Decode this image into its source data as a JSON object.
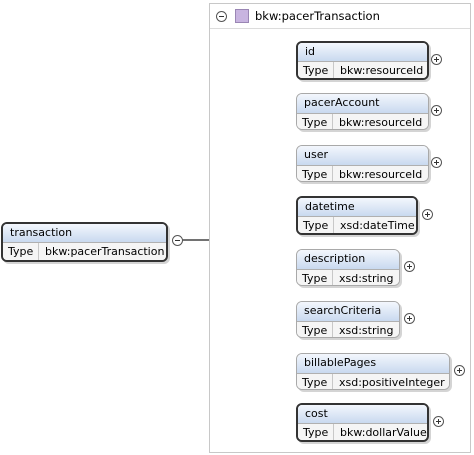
{
  "root": {
    "name": "transaction",
    "type_label": "Type",
    "type_value": "bkw:pacerTransaction"
  },
  "panel": {
    "title": "bkw:pacerTransaction"
  },
  "children": [
    {
      "name": "id",
      "type_label": "Type",
      "type_value": "bkw:resourceId",
      "required": true
    },
    {
      "name": "pacerAccount",
      "type_label": "Type",
      "type_value": "bkw:resourceId",
      "required": false
    },
    {
      "name": "user",
      "type_label": "Type",
      "type_value": "bkw:resourceId",
      "required": false
    },
    {
      "name": "datetime",
      "type_label": "Type",
      "type_value": "xsd:dateTime",
      "required": true
    },
    {
      "name": "description",
      "type_label": "Type",
      "type_value": "xsd:string",
      "required": false
    },
    {
      "name": "searchCriteria",
      "type_label": "Type",
      "type_value": "xsd:string",
      "required": false
    },
    {
      "name": "billablePages",
      "type_label": "Type",
      "type_value": "xsd:positiveInteger",
      "required": false
    },
    {
      "name": "cost",
      "type_label": "Type",
      "type_value": "bkw:dollarValue",
      "required": true
    }
  ],
  "icons": {
    "collapse": "minus-circle-icon",
    "expand": "plus-circle-icon",
    "complex_type": "complex-type-square-icon",
    "compositor": "sequence-compositor-icon"
  },
  "colors": {
    "header_top": "#f3f7fd",
    "header_bottom": "#c9d9ef",
    "complex_type": "#c8b4e0",
    "compositor": "#f6efb4"
  }
}
